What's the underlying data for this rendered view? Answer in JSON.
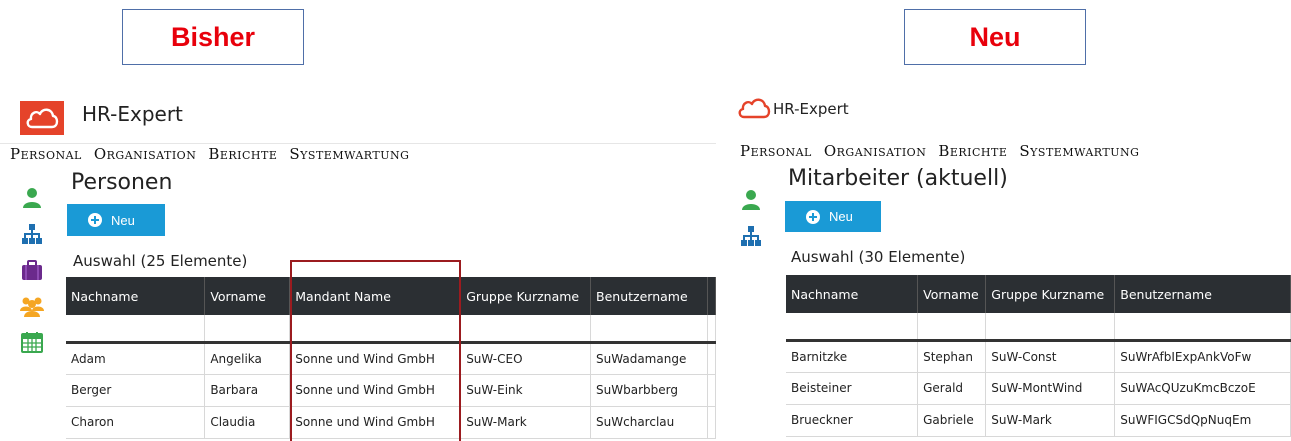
{
  "labels": {
    "left": "Bisher",
    "right": "Neu"
  },
  "left": {
    "app_title": "HR-Expert",
    "menu": [
      "Personal",
      "Organisation",
      "Berichte",
      "Systemwartung"
    ],
    "page_title": "Personen",
    "new_button": "Neu",
    "selection_label": "Auswahl (25 Elemente)",
    "columns": [
      "Nachname",
      "Vorname",
      "Mandant Name",
      "Gruppe Kurzname",
      "Benutzername"
    ],
    "rows": [
      [
        "Adam",
        "Angelika",
        "Sonne und Wind GmbH",
        "SuW-CEO",
        "SuWadamange"
      ],
      [
        "Berger",
        "Barbara",
        "Sonne und Wind GmbH",
        "SuW-Eink",
        "SuWbarbberg"
      ],
      [
        "Charon",
        "Claudia",
        "Sonne und Wind GmbH",
        "SuW-Mark",
        "SuWcharclau"
      ]
    ]
  },
  "right": {
    "app_title": "HR-Expert",
    "menu": [
      "Personal",
      "Organisation",
      "Berichte",
      "Systemwartung"
    ],
    "page_title": "Mitarbeiter (aktuell)",
    "new_button": "Neu",
    "selection_label": "Auswahl (30 Elemente)",
    "columns": [
      "Nachname",
      "Vorname",
      "Gruppe Kurzname",
      "Benutzername"
    ],
    "rows": [
      [
        "Barnitzke",
        "Stephan",
        "SuW-Const",
        "SuWrAfbIExpAnkVoFw"
      ],
      [
        "Beisteiner",
        "Gerald",
        "SuW-MontWind",
        "SuWAcQUzuKmcBczoE"
      ],
      [
        "Brueckner",
        "Gabriele",
        "SuW-Mark",
        "SuWFIGCSdQpNuqEm"
      ]
    ]
  },
  "colors": {
    "accent": "#1a9ad6",
    "label_red": "#e8000b",
    "logo": "#e5432a",
    "header_dark": "#2b2f33",
    "highlight_frame": "#9b1b1f"
  },
  "icons": [
    "person-icon",
    "org-chart-icon",
    "briefcase-icon",
    "group-icon",
    "calendar-icon"
  ]
}
